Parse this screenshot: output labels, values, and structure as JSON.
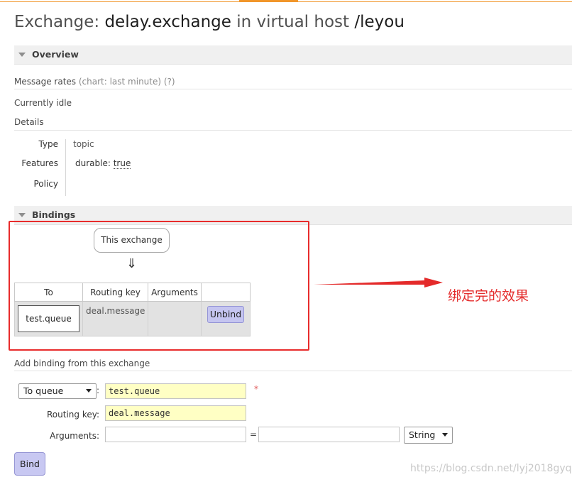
{
  "header": {
    "prefix": "Exchange: ",
    "exchange_name": "delay.exchange",
    "middle": " in virtual host ",
    "vhost": "/leyou"
  },
  "overview": {
    "section_title": "Overview",
    "message_rates_label": "Message rates",
    "message_rates_chart": " (chart: last minute) (?)",
    "idle_text": "Currently idle",
    "details_label": "Details",
    "type_label": "Type",
    "type_value": "topic",
    "features_label": "Features",
    "features_key": "durable:",
    "features_value": "true",
    "policy_label": "Policy"
  },
  "bindings": {
    "section_title": "Bindings",
    "this_exchange": "This exchange",
    "arrow": "⇓",
    "columns": [
      "To",
      "Routing key",
      "Arguments",
      ""
    ],
    "rows": [
      {
        "to": "test.queue",
        "routing_key": "deal.message",
        "arguments": "",
        "action": "Unbind"
      }
    ]
  },
  "annotation": {
    "note": "绑定完的效果",
    "color": "#e42a2a"
  },
  "add_binding": {
    "title": "Add binding from this exchange",
    "destination_type": "To queue",
    "destination_colon": ":",
    "destination_value": "test.queue",
    "required_mark": "*",
    "routing_key_label": "Routing key:",
    "routing_key_value": "deal.message",
    "arguments_label": "Arguments:",
    "arguments_key": "",
    "equals": "=",
    "arguments_value": "",
    "arguments_type": "String",
    "bind_label": "Bind"
  },
  "watermark": "https://blog.csdn.net/lyj2018gyq"
}
